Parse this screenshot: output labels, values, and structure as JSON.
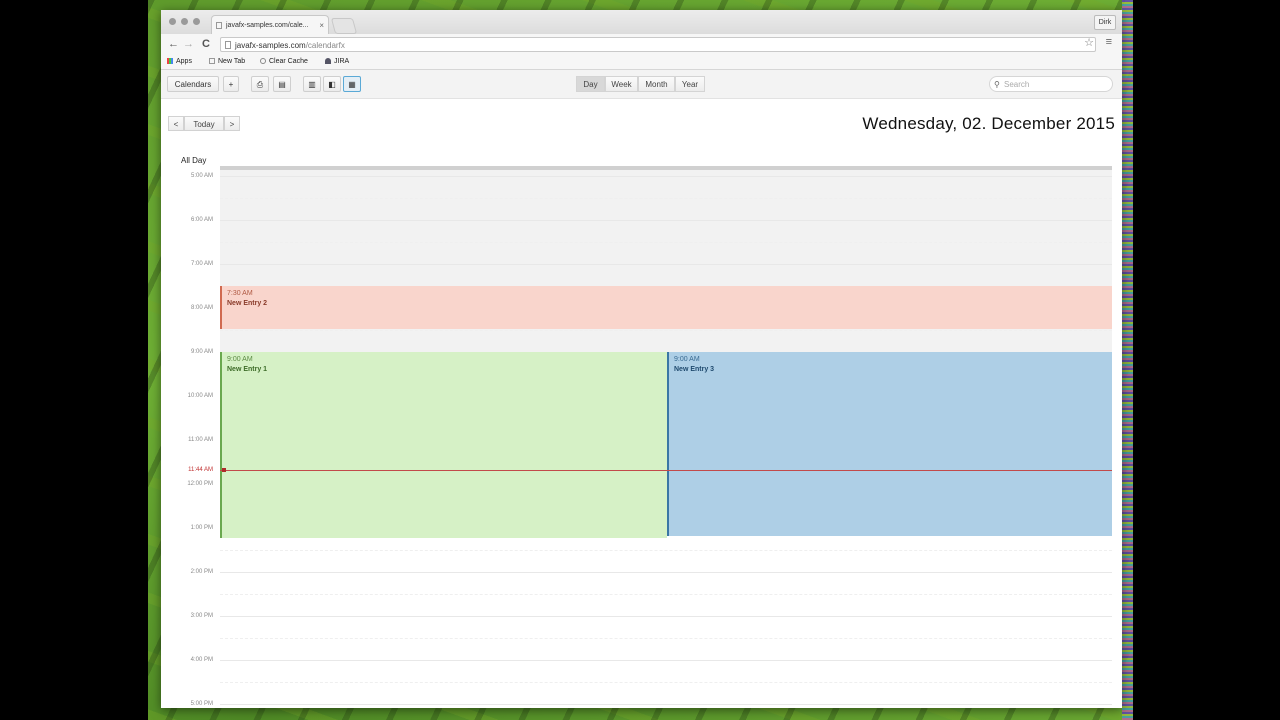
{
  "browser": {
    "tab_title": "javafx-samples.com/cale...",
    "tab_close": "×",
    "user_button": "Dirk",
    "back": "←",
    "forward": "→",
    "reload": "C",
    "url_domain": "javafx-samples.com",
    "url_path": "/calendarfx",
    "star_icon": "☆",
    "menu_icon": "≡",
    "bookmarks": [
      "Apps",
      "New Tab",
      "Clear Cache",
      "JIRA"
    ]
  },
  "toolbar": {
    "calendars_label": "Calendars",
    "add_label": "+",
    "views": [
      "Day",
      "Week",
      "Month",
      "Year"
    ],
    "selected_view": "Day",
    "search_placeholder": "Search",
    "search_icon": "🔍"
  },
  "date_nav": {
    "prev": "<",
    "today": "Today",
    "next": ">",
    "current_date": "Wednesday, 02. December 2015"
  },
  "day_view": {
    "all_day_label": "All Day",
    "hours": [
      "5:00 AM",
      "6:00 AM",
      "7:00 AM",
      "8:00 AM",
      "9:00 AM",
      "10:00 AM",
      "11:00 AM",
      "12:00 PM",
      "1:00 PM",
      "2:00 PM",
      "3:00 PM",
      "4:00 PM",
      "5:00 PM"
    ],
    "current_time": "11:44 AM",
    "entries": [
      {
        "time": "7:30 AM",
        "title": "New Entry 2",
        "color": "#f9d5cc"
      },
      {
        "time": "9:00 AM",
        "title": "New Entry 1",
        "color": "#d6f1c6"
      },
      {
        "time": "9:00 AM",
        "title": "New Entry 3",
        "color": "#aecfe6"
      }
    ]
  }
}
